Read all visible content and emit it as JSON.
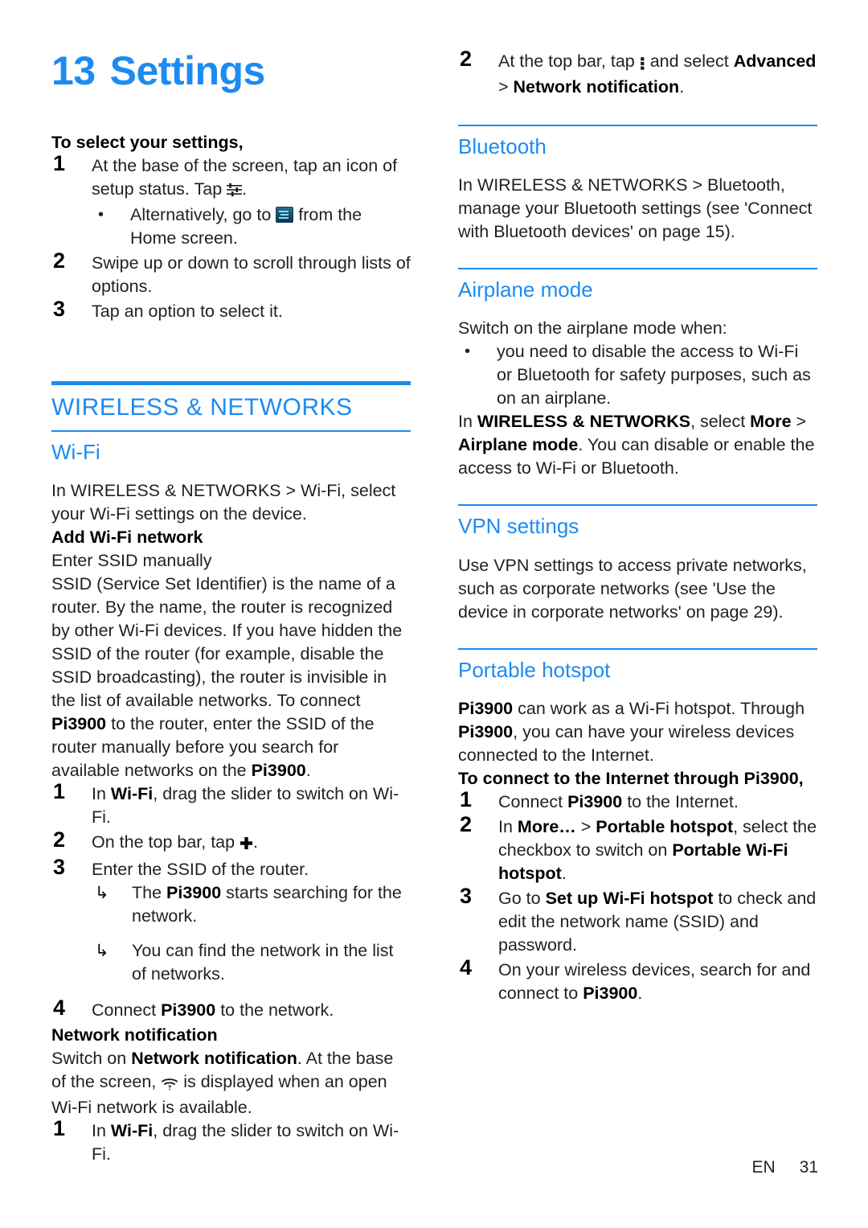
{
  "page": {
    "chapter_number": "13",
    "chapter_title": "Settings",
    "footer_language": "EN",
    "footer_page_number": "31",
    "accent_color": "#1d8bf1",
    "text_color": "#231f20"
  },
  "left_column": {
    "intro_heading": "To select your settings,",
    "intro_steps": [
      {
        "num": "1",
        "text_before_icon": "At the base of the screen, tap an icon of setup status. Tap ",
        "icon": "sliders-icon",
        "text_after_icon": ".",
        "sub_bullets": [
          {
            "bullet": "•",
            "text_before_icon": "Alternatively, go to ",
            "icon": "settings-app-icon",
            "text_after_icon": " from the Home screen."
          }
        ]
      },
      {
        "num": "2",
        "text": "Swipe up or down to scroll through lists of options."
      },
      {
        "num": "3",
        "text": "Tap an option to select it."
      }
    ],
    "major_section_heading": "WIRELESS & NETWORKS",
    "wifi": {
      "heading": "Wi-Fi",
      "intro": "In WIRELESS & NETWORKS > Wi-Fi, select your Wi-Fi settings on the device.",
      "add_network_heading": "Add Wi-Fi network",
      "enter_ssid_heading": "Enter SSID manually",
      "ssid_paragraph_part1": "SSID (Service Set Identifier) is the name of a router. By the name, the router is recognized by other Wi-Fi devices. If you have hidden the SSID of the router (for example, disable the SSID broadcasting), the router is invisible in the list of available networks. To connect ",
      "ssid_paragraph_bold1": "Pi3900",
      "ssid_paragraph_part2": " to the router, enter the SSID of the router manually before you search for available networks on the ",
      "ssid_paragraph_bold2": "Pi3900",
      "ssid_paragraph_part3": ".",
      "steps": [
        {
          "num": "1",
          "pre": "In ",
          "bold": "Wi-Fi",
          "post": ", drag the slider to switch on Wi-Fi."
        },
        {
          "num": "2",
          "pre": "On the top bar, tap ",
          "icon": "plus-icon",
          "post": "."
        },
        {
          "num": "3",
          "text": "Enter the SSID of the router.",
          "results": [
            {
              "arrow": "↳",
              "pre": "The ",
              "bold": "Pi3900",
              "post": " starts searching for the network."
            },
            {
              "arrow": "↳",
              "pre": "",
              "bold": "",
              "post": "You can find the network in the list of networks."
            }
          ]
        },
        {
          "num": "4",
          "pre": "Connect ",
          "bold": "Pi3900",
          "post": " to the network."
        }
      ],
      "notification_heading": "Network notification",
      "notification_pre": "Switch on ",
      "notification_bold": "Network notification",
      "notification_mid": ". At the base of the screen, ",
      "notification_icon": "wifi-question-icon",
      "notification_post": " is displayed when an open Wi-Fi network is available.",
      "notification_steps": [
        {
          "num": "1",
          "pre": "In ",
          "bold": "Wi-Fi",
          "post": ", drag the slider to switch on Wi-Fi."
        }
      ]
    }
  },
  "right_column": {
    "continued_step": {
      "num": "2",
      "pre": "At the top bar, tap ",
      "icon": "kebab-menu-icon",
      "mid": " and select ",
      "bold1": "Advanced",
      "mid2": " > ",
      "bold2": "Network notification",
      "post": "."
    },
    "bluetooth": {
      "heading": "Bluetooth",
      "body": "In WIRELESS & NETWORKS > Bluetooth, manage your Bluetooth settings (see 'Connect with Bluetooth devices' on page 15)."
    },
    "airplane": {
      "heading": "Airplane mode",
      "intro": "Switch on the airplane mode when:",
      "bullets": [
        {
          "bullet": "•",
          "text": "you need to disable the access to Wi-Fi or Bluetooth for safety purposes, such as on an airplane."
        }
      ],
      "body_pre": "In ",
      "body_bold1": "WIRELESS & NETWORKS",
      "body_mid1": ", select ",
      "body_bold2": "More",
      "body_mid2": " > ",
      "body_bold3": "Airplane mode",
      "body_post": ". You can disable or enable the access to Wi-Fi or Bluetooth."
    },
    "vpn": {
      "heading": "VPN settings",
      "body": "Use VPN settings to access private networks, such as corporate networks (see 'Use the device in corporate networks' on page 29)."
    },
    "hotspot": {
      "heading": "Portable hotspot",
      "body_bold1": "Pi3900",
      "body_mid1": " can work as a Wi-Fi hotspot. Through ",
      "body_bold2": "Pi3900",
      "body_post": ", you can have your wireless devices connected to the Internet.",
      "connect_heading": "To connect to the Internet through Pi3900,",
      "steps": [
        {
          "num": "1",
          "pre": "Connect ",
          "bold": "Pi3900",
          "post": " to the Internet."
        },
        {
          "num": "2",
          "pre": "In ",
          "bold": "More…",
          "mid": " > ",
          "bold2": "Portable hotspot",
          "mid2": ", select the checkbox to switch on ",
          "bold3": "Portable Wi-Fi hotspot",
          "post": "."
        },
        {
          "num": "3",
          "pre": "Go to ",
          "bold": "Set up Wi-Fi hotspot",
          "post": " to check and edit the network name (SSID) and password."
        },
        {
          "num": "4",
          "pre": "On your wireless devices, search for and connect to ",
          "bold": "Pi3900",
          "post": "."
        }
      ]
    }
  }
}
